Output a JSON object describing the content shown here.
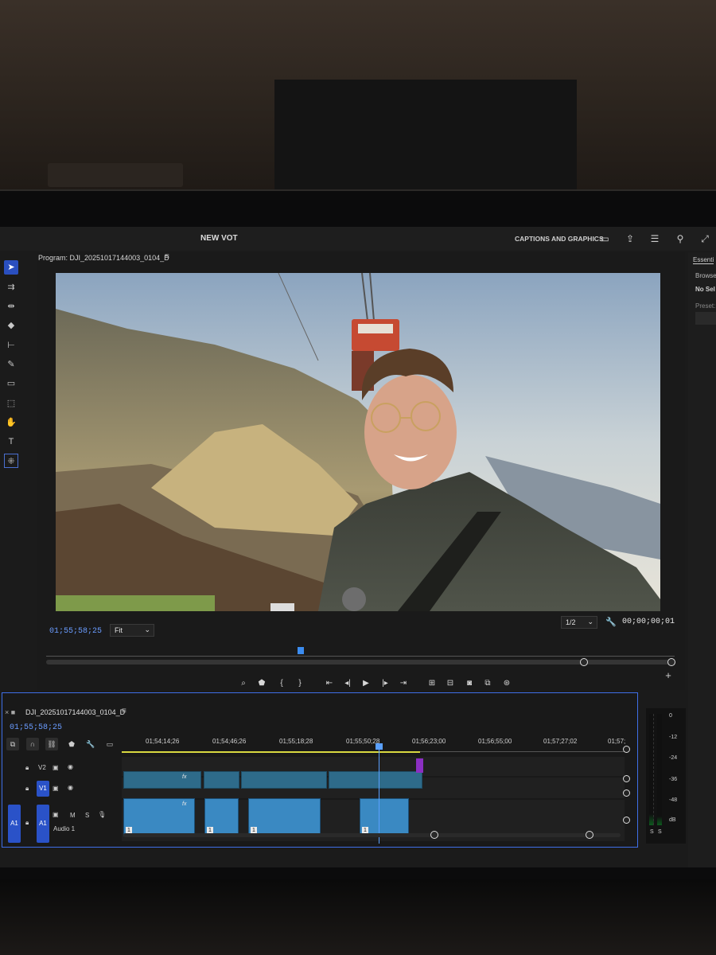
{
  "app": {
    "project_title": "NEW VOT",
    "workspace_label": "CAPTIONS AND GRAPHICS"
  },
  "tools": [
    "selection-tool",
    "track-select-tool",
    "ripple-edit-tool",
    "razor-tool",
    "slip-tool",
    "pen-tool",
    "rectangle-tool",
    "hand-tool",
    "type-tool",
    "remix-tool"
  ],
  "program_monitor": {
    "title": "Program: DJI_20251017144003_0104_D",
    "current_tc": "01;55;58;25",
    "zoom": "Fit",
    "resolution": "1/2",
    "duration_tc": "00;00;00;01"
  },
  "right_panel": {
    "tab": "Essenti",
    "browse": "Browse",
    "no_selection": "No Sel",
    "preset": "Preset:"
  },
  "timeline": {
    "sequence_name": "DJI_20251017144003_0104_D",
    "current_tc": "01;55;58;25",
    "ruler_labels": [
      "01;54;14;26",
      "01;54;46;26",
      "01;55;18;28",
      "01;55;50;28",
      "01;56;23;00",
      "01;56;55;00",
      "01;57;27;02",
      "01;57;"
    ],
    "tracks": {
      "v2": "V2",
      "v1": "V1",
      "a1_source": "A1",
      "a1": "A1",
      "a1_name": "Audio 1",
      "m": "M",
      "s": "S"
    },
    "fx_label": "fx",
    "clip_number": "1"
  },
  "meter": {
    "labels": [
      "0",
      "-12",
      "-24",
      "-36",
      "-48",
      "dB"
    ],
    "solo": [
      "S",
      "S"
    ]
  },
  "colors": {
    "accent_blue": "#3f6fe8",
    "timecode_blue": "#6a9cff",
    "video_clip": "#2e6b8a",
    "audio_clip": "#3a89c2",
    "work_area_yellow": "#d8d840",
    "marker_purple": "#8b2fc2"
  }
}
